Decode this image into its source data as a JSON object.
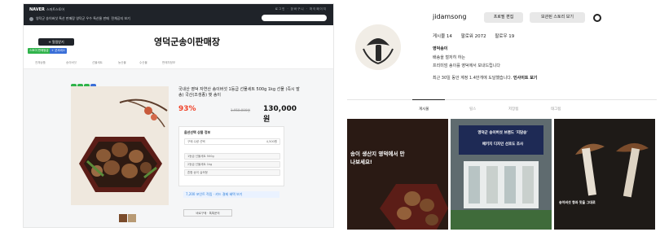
{
  "store": {
    "brand": "NAVER",
    "brand_sub": "스마트스토어",
    "notice": "영덕군 송이버섯 특산 판매장 영덕군 우수 특산물 판매",
    "notice_link": "전체공지 보기",
    "util_links": "로그인 · 장바구니 · 마이페이지",
    "favorite_button": "+ 알림받기",
    "grade1": "스토어 판매등급 빅파워",
    "grade2": "+ 굿서비스",
    "store_name": "영덕군송이판매장",
    "menu": [
      "전체상품",
      "송이버섯",
      "선물세트",
      "농산물",
      "수산물",
      "판매자정보"
    ],
    "product_title": "국내산 영덕 자연산 송이버섯 1등급 선물세트 500g 1kg 선물 (즉시 발송) 국산(조생종) 햇 송이",
    "discount": "93%",
    "old_price": "1,950,000원",
    "price": "130,000원",
    "option_label": "옵션선택 상품 정보",
    "options": [
      "구매 수량 선택",
      "1등급 선물세트 500g",
      "2등급 선물세트 1kg",
      "혼합 송이 실속형"
    ],
    "option_price": "4,500원",
    "benefit": "7,200 포인트 적립 · 카드 결제 혜택 보기",
    "buy_button": "바로구매 · 톡톡문의"
  },
  "profile": {
    "username": "jidamsong",
    "buttons": [
      "프로필 편집",
      "보관된 스토리 보기"
    ],
    "stats": [
      "게시물 14",
      "팔로워 2072",
      "팔로우 19"
    ],
    "display_name": "영덕송이",
    "bio_line1": "배송을 철저히 하는",
    "bio_line2": "프리미엄 송이를 영덕에서 보내드립니다",
    "bio_line3": "최근 30일 동안 계정 1.4만개에 도달했습니다.",
    "insight_link": "인사이트 보기",
    "tabs": [
      "게시물",
      "릴스",
      "저장됨",
      "태그됨"
    ],
    "post1_text": "송이 생산지 영덕에서 만나보세요!",
    "post2_title": "영덕군 송이버섯 브랜드 '지담송'",
    "post2_sub": "패키지 디자인 선호도 조사",
    "post3_text": "송이버섯 향과 맛을 그대로"
  }
}
